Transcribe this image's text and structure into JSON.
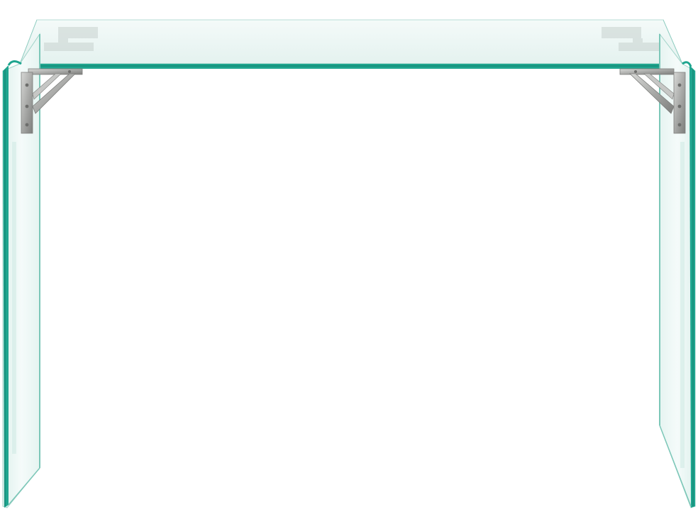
{
  "scene": {
    "subject": "glass-console-table",
    "background_color": "#ffffff",
    "colors": {
      "glass_edge": "#1fa58f",
      "glass_edge_dark": "#0f7d6b",
      "glass_tint": "#e9f5f3",
      "glass_tint_light": "#f6fbfa",
      "bracket_metal": "#a9aaa8",
      "bracket_metal_dark": "#7d7e7c",
      "bracket_highlight": "#dcdcda"
    }
  }
}
